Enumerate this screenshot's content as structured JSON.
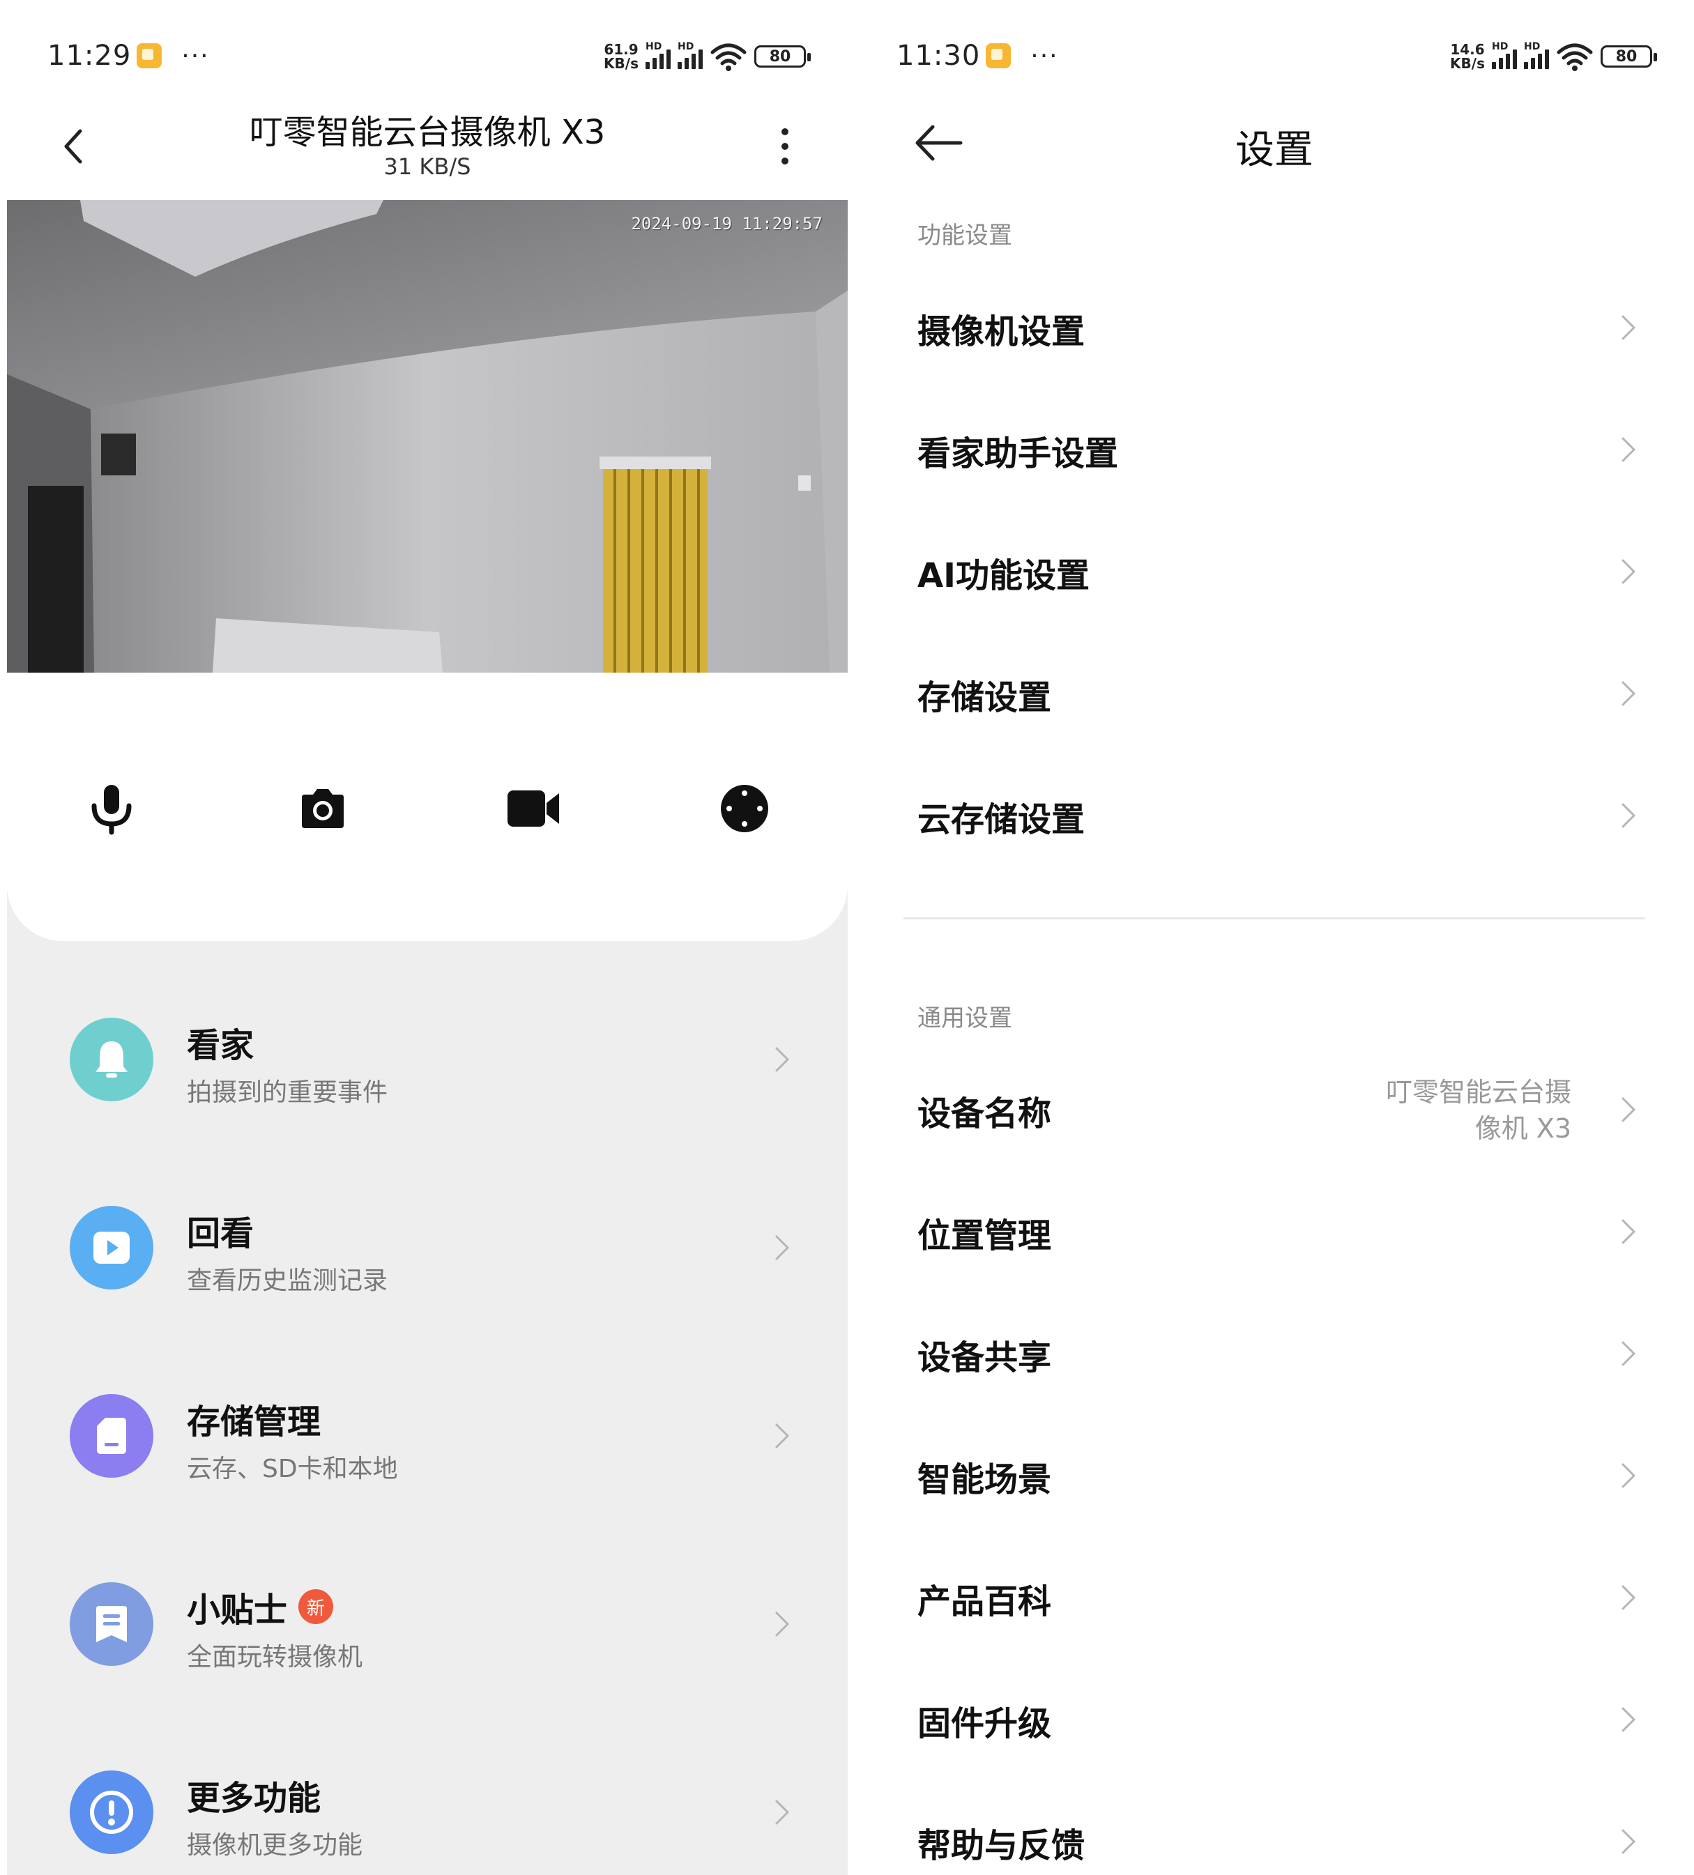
{
  "left_screen": {
    "status_bar": {
      "time": "11:29",
      "dots": "···",
      "speed_value": "61.9",
      "speed_unit": "KB/s",
      "hd1": "HD",
      "hd2": "HD",
      "battery": "80"
    },
    "header": {
      "title": "叮零智能云台摄像机 X3",
      "subtitle": "31 KB/S"
    },
    "video": {
      "timestamp": "2024-09-19  11:29:57"
    },
    "controls": [
      "microphone-icon",
      "camera-icon",
      "video-record-icon",
      "ptz-control-icon"
    ],
    "features": [
      {
        "title": "看家",
        "subtitle": "拍摄到的重要事件",
        "icon": "bell-icon",
        "color": "#6fcfcf"
      },
      {
        "title": "回看",
        "subtitle": "查看历史监测记录",
        "icon": "play-icon",
        "color": "#5aaef2"
      },
      {
        "title": "存储管理",
        "subtitle": "云存、SD卡和本地",
        "icon": "storage-icon",
        "color": "#8a7ef0"
      },
      {
        "title": "小贴士",
        "badge": "新",
        "subtitle": "全面玩转摄像机",
        "icon": "tips-icon",
        "color": "#7f9de0"
      },
      {
        "title": "更多功能",
        "subtitle": "摄像机更多功能",
        "icon": "info-icon",
        "color": "#5b8ff0"
      }
    ]
  },
  "right_screen": {
    "status_bar": {
      "time": "11:30",
      "dots": "···",
      "speed_value": "14.6",
      "speed_unit": "KB/s",
      "hd1": "HD",
      "hd2": "HD",
      "battery": "80"
    },
    "title": "设置",
    "section_function": "功能设置",
    "function_items": [
      "摄像机设置",
      "看家助手设置",
      "AI功能设置",
      "存储设置",
      "云存储设置"
    ],
    "section_general": "通用设置",
    "general_items": [
      {
        "label": "设备名称",
        "value_line1": "叮零智能云台摄",
        "value_line2": "像机 X3"
      },
      {
        "label": "位置管理"
      },
      {
        "label": "设备共享"
      },
      {
        "label": "智能场景"
      },
      {
        "label": "产品百科"
      },
      {
        "label": "固件升级"
      },
      {
        "label": "帮助与反馈"
      }
    ]
  }
}
